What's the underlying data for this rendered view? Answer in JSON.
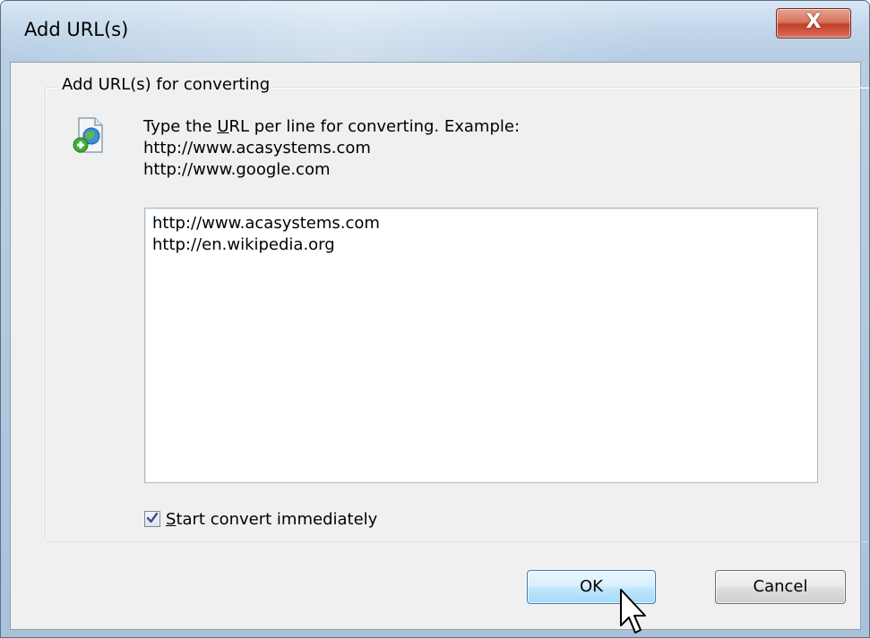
{
  "window": {
    "title": "Add URL(s)",
    "close_glyph": "X"
  },
  "group": {
    "label": "Add URL(s) for converting"
  },
  "instructions": {
    "line1_prefix": "Type the ",
    "line1_underlined": "U",
    "line1_suffix": "RL per line for converting. Example:",
    "line2": "http://www.acasystems.com",
    "line3": "http://www.google.com"
  },
  "url_input": {
    "value": "http://www.acasystems.com\nhttp://en.wikipedia.org"
  },
  "checkbox": {
    "checked": true,
    "label_underlined": "S",
    "label_rest": "tart convert immediately"
  },
  "buttons": {
    "ok_label": "OK",
    "cancel_label": "Cancel"
  },
  "icons": {
    "close": "close-icon",
    "add_url": "add-url-globe-icon",
    "checkmark": "checkmark-icon",
    "cursor": "mouse-pointer-icon"
  }
}
